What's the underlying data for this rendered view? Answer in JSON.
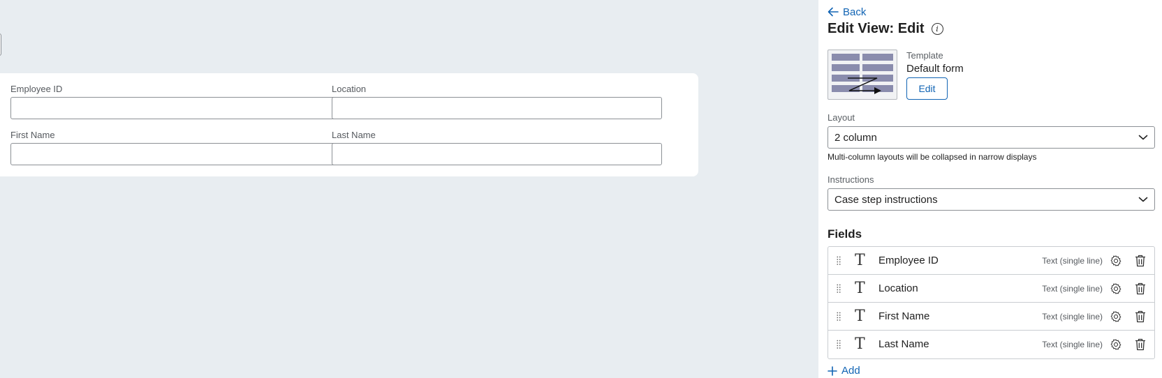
{
  "colors": {
    "accent": "#1164b4",
    "canvas_bg": "#e8edf1",
    "panel_bg": "#ffffff"
  },
  "canvas": {
    "form_fields": [
      {
        "label": "Employee ID"
      },
      {
        "label": "Location"
      },
      {
        "label": "First Name"
      },
      {
        "label": "Last Name"
      }
    ]
  },
  "panel": {
    "back_label": "Back",
    "title": "Edit View: Edit",
    "info_icon": "info-icon",
    "template": {
      "label": "Template",
      "value": "Default form",
      "edit_button": "Edit"
    },
    "layout": {
      "label": "Layout",
      "value": "2 column",
      "hint": "Multi-column layouts will be collapsed in narrow displays"
    },
    "instructions": {
      "label": "Instructions",
      "value": "Case step instructions"
    },
    "fields_heading": "Fields",
    "fields": [
      {
        "name": "Employee ID",
        "type": "Text (single line)"
      },
      {
        "name": "Location",
        "type": "Text (single line)"
      },
      {
        "name": "First Name",
        "type": "Text (single line)"
      },
      {
        "name": "Last Name",
        "type": "Text (single line)"
      }
    ],
    "add_label": "Add"
  }
}
